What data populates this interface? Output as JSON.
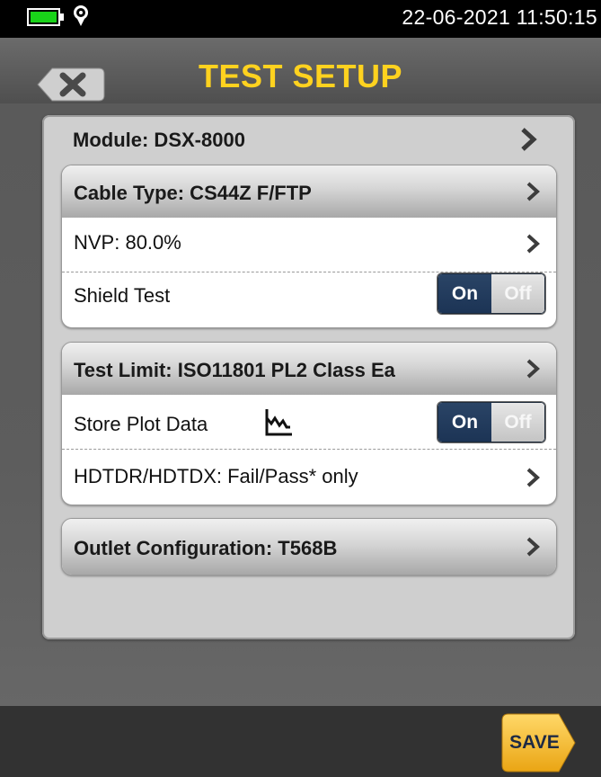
{
  "status_bar": {
    "datetime": "22-06-2021 11:50:15",
    "battery_color": "#19d319"
  },
  "header": {
    "title": "TEST SETUP",
    "title_color": "#ffd21f",
    "back_icon": "close-x-icon"
  },
  "module": {
    "label": "Module: DSX-8000"
  },
  "cable_card": {
    "title": "Cable Type: CS44Z F/FTP",
    "nvp_label": "NVP: 80.0%",
    "shield_label": "Shield Test",
    "shield_on": "On",
    "shield_off": "Off"
  },
  "limit_card": {
    "title": "Test Limit: ISO11801 PL2 Class Ea",
    "store_label": "Store Plot Data",
    "store_icon": "plot-graph-icon",
    "store_on": "On",
    "store_off": "Off",
    "hdtdr_label": "HDTDR/HDTDX: Fail/Pass* only"
  },
  "outlet": {
    "title": "Outlet Configuration: T568B"
  },
  "footer": {
    "save_label": "SAVE",
    "save_color": "#f5b821"
  }
}
